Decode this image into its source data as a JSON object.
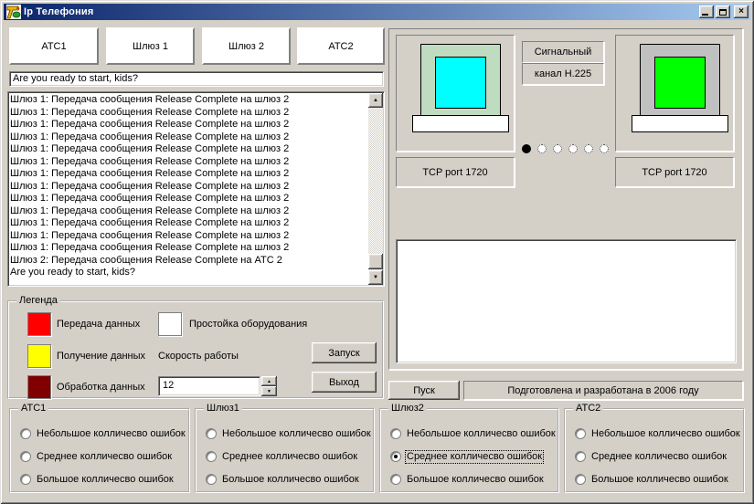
{
  "window": {
    "title": "Ip Телефония",
    "close_glyph": "×"
  },
  "icons": {
    "arrow_up": "▲",
    "arrow_down": "▼"
  },
  "device_panels": [
    {
      "label": "АТС1"
    },
    {
      "label": "Шлюз 1"
    },
    {
      "label": "Шлюз 2"
    },
    {
      "label": "АТС2"
    }
  ],
  "message_input": {
    "value": "Are you ready to start, kids?"
  },
  "log": {
    "lines": [
      "Шлюз 1: Передача сообщения Release Complete на шлюз 2",
      "Шлюз 1: Передача сообщения Release Complete на шлюз 2",
      "Шлюз 1: Передача сообщения Release Complete на шлюз 2",
      "Шлюз 1: Передача сообщения Release Complete на шлюз 2",
      "Шлюз 1: Передача сообщения Release Complete на шлюз 2",
      "Шлюз 1: Передача сообщения Release Complete на шлюз 2",
      "Шлюз 1: Передача сообщения Release Complete на шлюз 2",
      "Шлюз 1: Передача сообщения Release Complete на шлюз 2",
      "Шлюз 1: Передача сообщения Release Complete на шлюз 2",
      "Шлюз 1: Передача сообщения Release Complete на шлюз 2",
      "Шлюз 1: Передача сообщения Release Complete на шлюз 2",
      "Шлюз 1: Передача сообщения Release Complete на шлюз 2",
      "Шлюз 1: Передача сообщения Release Complete на шлюз 2",
      "Шлюз 2: Передача сообщения Release Complete на АТС 2",
      "Are you ready to start, kids?"
    ]
  },
  "legend": {
    "title": "Легенда",
    "items": [
      {
        "color": "#ff0000",
        "label": "Передача данных"
      },
      {
        "color": "#ffff00",
        "label": "Получение данных"
      },
      {
        "color": "#800000",
        "label": "Обработка данных"
      },
      {
        "color": "#ffffff",
        "label": "Простойка оборудования"
      }
    ],
    "speed_label": "Скорость работы",
    "speed_value": "12",
    "start_button": "Запуск",
    "exit_button": "Выход"
  },
  "network": {
    "signal_label_top": "Сигнальный",
    "signal_label_bottom": "канал Н.225",
    "tcp_left": "TCP port 1720",
    "tcp_right": "TCP port 1720",
    "dots_count": 6,
    "active_dot_index": 0,
    "monitor_left_body": "#c0dcc0",
    "monitor_left_screen": "#00ffff",
    "monitor_right_body": "#c0c0c0",
    "monitor_right_screen": "#00ff00"
  },
  "footer": {
    "start_button": "Пуск",
    "credit_text": "Подготовлена и разработана в 2006 году"
  },
  "error_groups": [
    {
      "title": "АТС1",
      "options": [
        {
          "label": "Небольшое колличесво ошибок",
          "selected": false
        },
        {
          "label": "Среднее колличесво ошибок",
          "selected": false
        },
        {
          "label": "Большое колличесво ошибок",
          "selected": false
        }
      ]
    },
    {
      "title": "Шлюз1",
      "options": [
        {
          "label": "Небольшое колличесво ошибок",
          "selected": false
        },
        {
          "label": "Среднее колличесво ошибок",
          "selected": false
        },
        {
          "label": "Большое колличесво ошибок",
          "selected": false
        }
      ]
    },
    {
      "title": "Шлюз2",
      "options": [
        {
          "label": "Небольшое колличесво ошибок",
          "selected": false
        },
        {
          "label": "Среднее колличесво ошибок",
          "selected": true
        },
        {
          "label": "Большое колличесво ошибок",
          "selected": false
        }
      ]
    },
    {
      "title": "АТС2",
      "options": [
        {
          "label": "Небольшое колличесво ошибок",
          "selected": false
        },
        {
          "label": "Среднее колличесво ошибок",
          "selected": false
        },
        {
          "label": "Большое колличесво ошибок",
          "selected": false
        }
      ]
    }
  ]
}
